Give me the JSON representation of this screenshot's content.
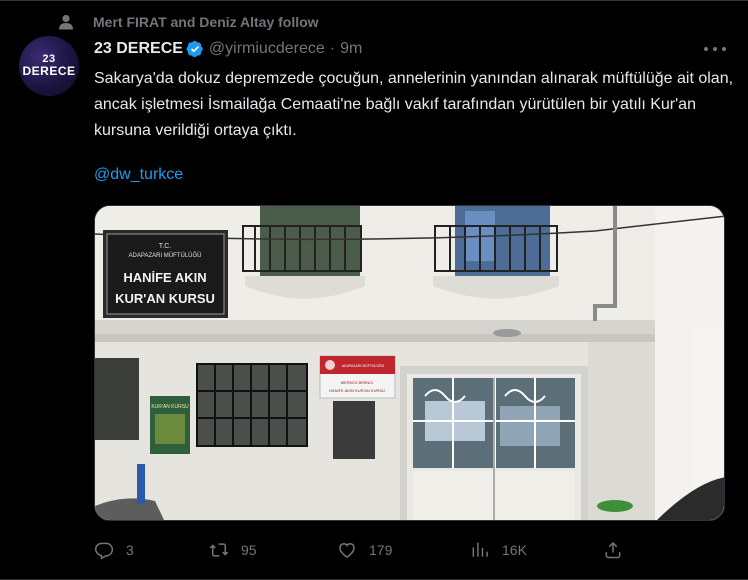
{
  "social_context": {
    "text": "Mert FIRAT and Deniz Altay follow"
  },
  "author": {
    "name": "23 DERECE",
    "handle": "@yirmiucderece",
    "separator": "·",
    "time": "9m",
    "avatar_line1": "23",
    "avatar_line2": "DERECE",
    "verified_color": "#1d9bf0"
  },
  "tweet": {
    "text": "Sakarya'da dokuz depremzede çocuğun, annelerinin yanından alınarak müftülüğe ait olan, ancak işletmesi İsmailağa Cemaati'ne bağlı vakıf tarafından yürütülen bir yatılı Kur'an kursuna verildiği ortaya çıktı.",
    "mention": "@dw_turkce"
  },
  "media": {
    "sign_top_line1": "T.C.",
    "sign_top_line2": "ADAPAZARI MÜFTÜLÜĞÜ",
    "sign_main_line1": "HANİFE AKIN",
    "sign_main_line2": "KUR'AN KURSU",
    "door_sign_small": "ADAPAZARI MÜFTÜLÜĞÜ",
    "door_sign_line1": "MERKEZ BİRİNCİ",
    "door_sign_line2": "HANİFE AKIN KUR'AN KURSU",
    "poster_text": "KUR'AN KURSU"
  },
  "actions": {
    "reply_count": "3",
    "retweet_count": "95",
    "like_count": "179",
    "views_count": "16K"
  },
  "icons": {
    "person": "person-icon",
    "more": "more-icon",
    "reply": "reply-icon",
    "retweet": "retweet-icon",
    "like": "heart-icon",
    "views": "views-icon",
    "share": "share-icon"
  }
}
